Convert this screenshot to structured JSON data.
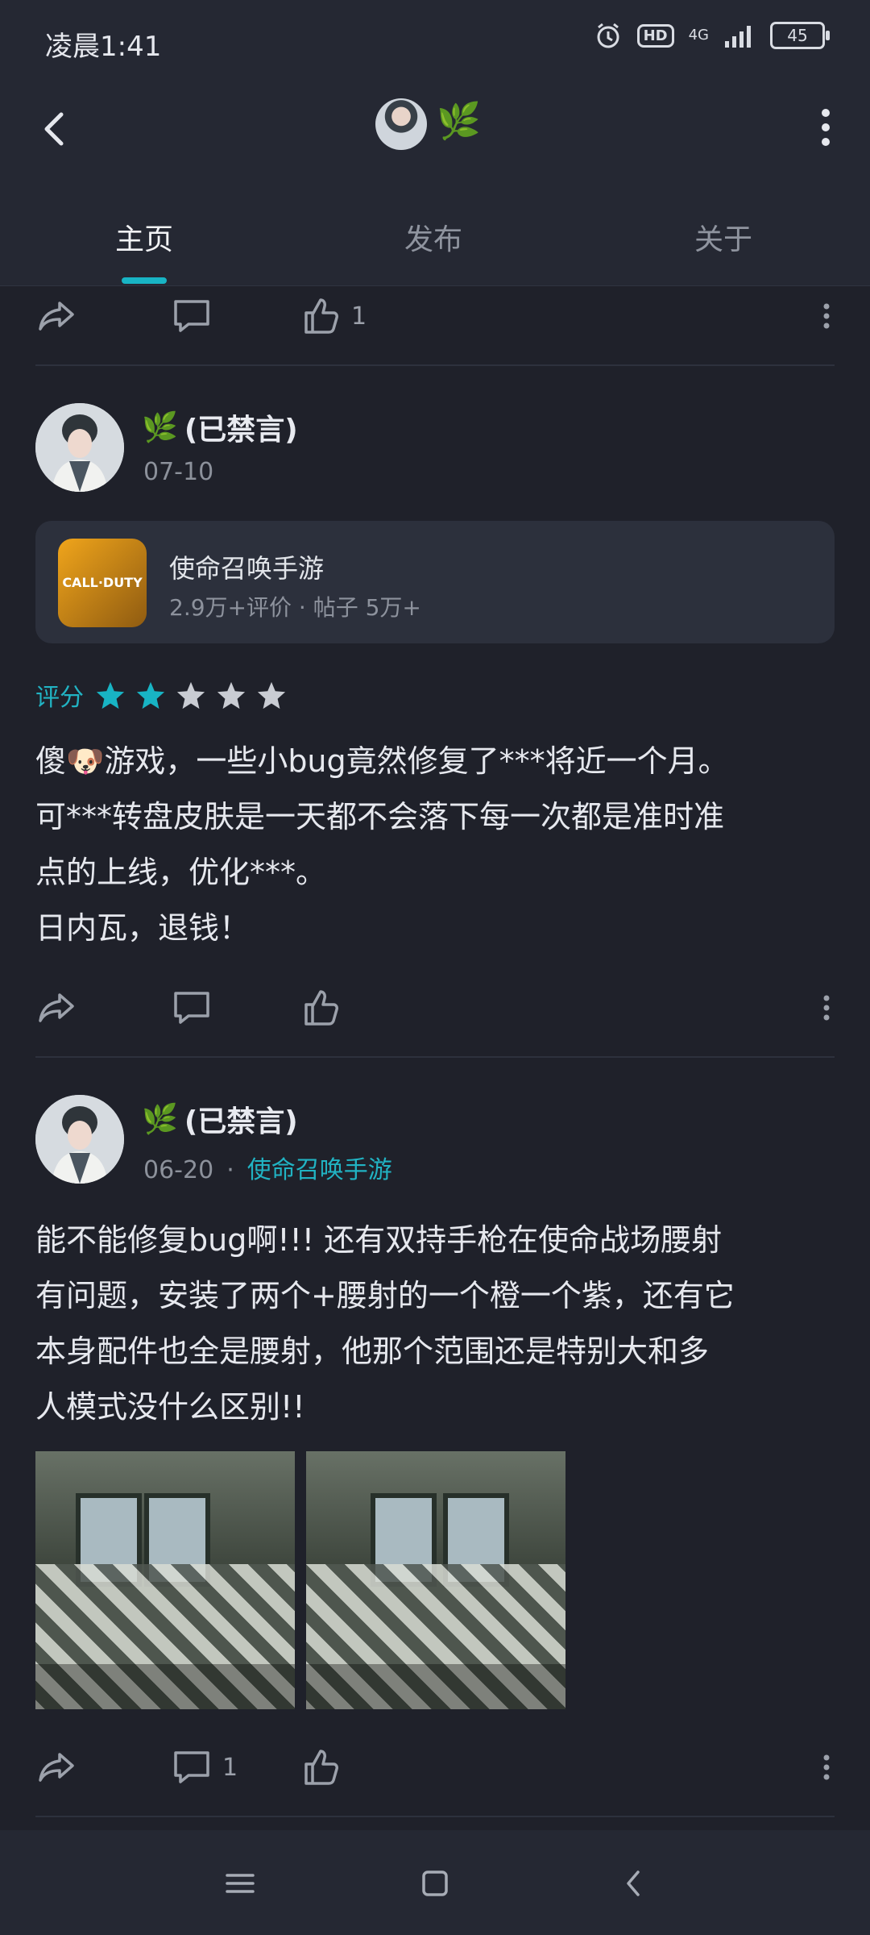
{
  "status": {
    "time": "凌晨1:41",
    "network": "4G",
    "hd": "HD",
    "battery": "45"
  },
  "header": {
    "leaf": "🌿"
  },
  "tabs": [
    {
      "label": "主页",
      "active": true
    },
    {
      "label": "发布",
      "active": false
    },
    {
      "label": "关于",
      "active": false
    }
  ],
  "top_partial_actions": {
    "like_count": "1"
  },
  "posts": [
    {
      "author_suffix": "(已禁言)",
      "date": "07-10",
      "game": {
        "title": "使命召唤手游",
        "meta": "2.9万+评价 · 帖子 5万+",
        "icon_text": "CALL·DUTY"
      },
      "rating_label": "评分",
      "rating": 2,
      "text": "傻🐶游戏，一些小bug竟然修复了***将近一个月。\n可***转盘皮肤是一天都不会落下每一次都是准时准\n点的上线，优化***。\n日内瓦，退钱！"
    },
    {
      "author_suffix": "(已禁言)",
      "date": "06-20",
      "sep": "·",
      "game_tag": "使命召唤手游",
      "text": "能不能修复bug啊!!! 还有双持手枪在使命战场腰射\n有问题，安装了两个+腰射的一个橙一个紫，还有它\n本身配件也全是腰射，他那个范围还是特别大和多\n人模式没什么区别!!",
      "comment_count": "1"
    }
  ],
  "colors": {
    "accent": "#18b4c4",
    "background": "#1f212a",
    "bar": "#252833"
  }
}
